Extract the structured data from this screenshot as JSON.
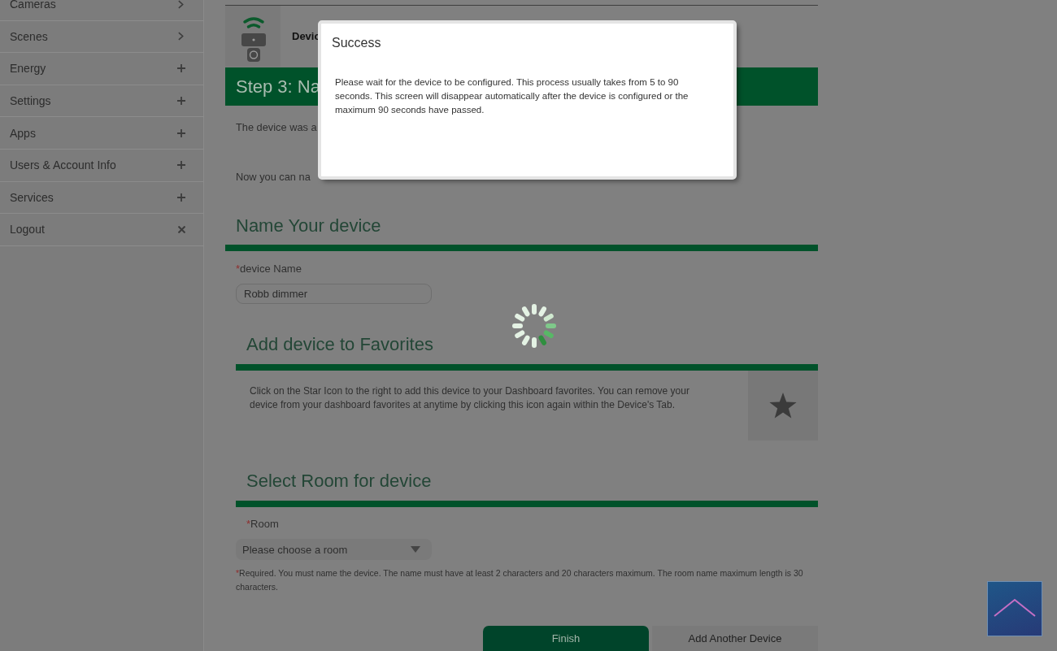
{
  "sidebar": {
    "items": [
      {
        "label": "Cameras",
        "kind": "chevron"
      },
      {
        "label": "Scenes",
        "kind": "chevron"
      },
      {
        "label": "Energy",
        "kind": "plus"
      },
      {
        "label": "Settings",
        "kind": "plus"
      },
      {
        "label": "Apps",
        "kind": "plus"
      },
      {
        "label": "Users & Account Info",
        "kind": "plus"
      },
      {
        "label": "Services",
        "kind": "plus"
      },
      {
        "label": "Logout",
        "kind": "close"
      }
    ]
  },
  "device_header": {
    "title": "Devic"
  },
  "step_banner": {
    "title": "Step 3: Na"
  },
  "intro_lines": [
    "The device was a",
    "Now you can na"
  ],
  "name_section": {
    "heading": "Name Your device",
    "field": {
      "required_mark": "*",
      "label": "device Name",
      "value": "Robb dimmer"
    }
  },
  "favorites_section": {
    "heading": "Add device to Favorites",
    "text": "Click on the Star Icon to the right to add this device to your Dashboard favorites. You can remove your device from your dashboard favorites at anytime by clicking this icon again within the Device's Tab."
  },
  "room_section": {
    "heading": "Select Room for device",
    "field": {
      "required_mark": "*",
      "label": "Room",
      "placeholder": "Please choose a room"
    },
    "note_mark": "*",
    "note": "Required. You must name the device. The name must have at least 2 characters and 20 characters maximum. The room name maximum length is 30 characters."
  },
  "buttons": [
    {
      "label": "Finish",
      "kind": "primary"
    },
    {
      "label": "Add Another Device",
      "kind": "secondary"
    }
  ],
  "dialog": {
    "title": "Success",
    "message": "Please wait for the device to be configured. This process usually takes from 5 to 90 seconds. This screen will disappear automatically after the device is configured or the maximum 90 seconds have passed."
  }
}
